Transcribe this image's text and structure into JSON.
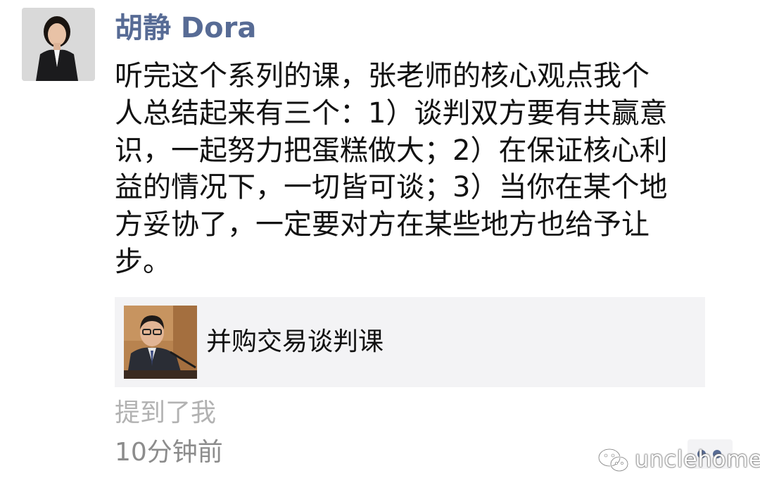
{
  "post": {
    "author": "胡静 Dora",
    "content_lines": [
      "听完这个系列的课，张老师的核心观点我个",
      "人总结起来有三个：1）谈判双方要有共赢意",
      "识，一起努力把蛋糕做大；2）在保证核心利",
      "益的情况下，一切皆可谈；3）当你在某个地",
      "方妥协了，一定要对方在某些地方也给予让",
      "步。"
    ],
    "share_card": {
      "title": "并购交易谈判课"
    },
    "mention_text": "提到了我",
    "time_text": "10分钟前"
  },
  "watermark": {
    "text": "unclehome",
    "icon": "wechat-icon"
  },
  "colors": {
    "author_name": "#576b95",
    "body_text": "#111111",
    "card_background": "#f3f3f5",
    "mention_text": "#b2b2b2",
    "time_text": "#8c8c8c"
  }
}
